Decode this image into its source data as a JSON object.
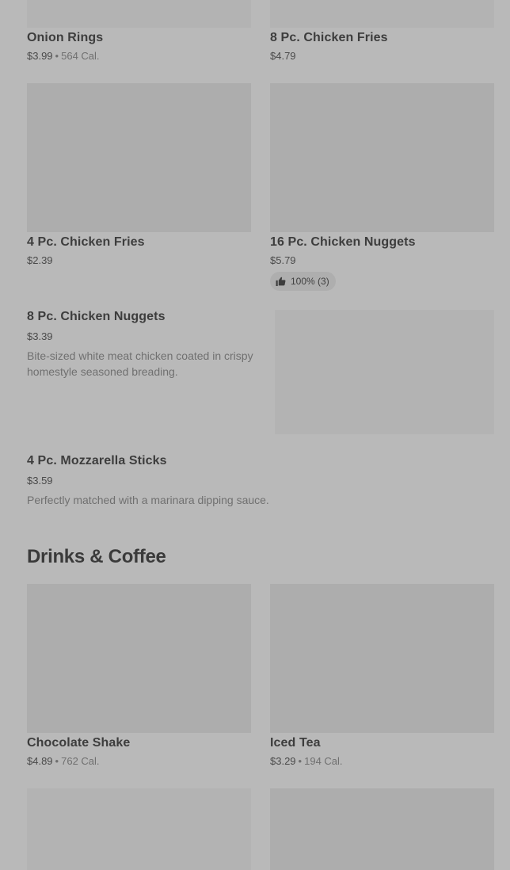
{
  "items": [
    {
      "name": "Onion Rings",
      "price": "$3.99",
      "calories": "564 Cal."
    },
    {
      "name": "8 Pc. Chicken Fries",
      "price": "$4.79"
    },
    {
      "name": "4 Pc. Chicken Fries",
      "price": "$2.39"
    },
    {
      "name": "16 Pc. Chicken Nuggets",
      "price": "$5.79",
      "rating": "100% (3)"
    },
    {
      "name": "8 Pc. Chicken Nuggets",
      "price": "$3.39",
      "description": "Bite-sized white meat chicken coated in crispy homestyle seasoned breading."
    },
    {
      "name": "4 Pc. Mozzarella Sticks",
      "price": "$3.59",
      "description": "Perfectly matched with a marinara dipping sauce."
    }
  ],
  "sections": {
    "drinks_title": "Drinks & Coffee"
  },
  "drinks": [
    {
      "name": "Chocolate Shake",
      "price": "$4.89",
      "calories": "762 Cal."
    },
    {
      "name": "Iced Tea",
      "price": "$3.29",
      "calories": "194 Cal."
    }
  ],
  "separator": "•",
  "icons": {
    "rating": "thumbs-up-icon"
  }
}
